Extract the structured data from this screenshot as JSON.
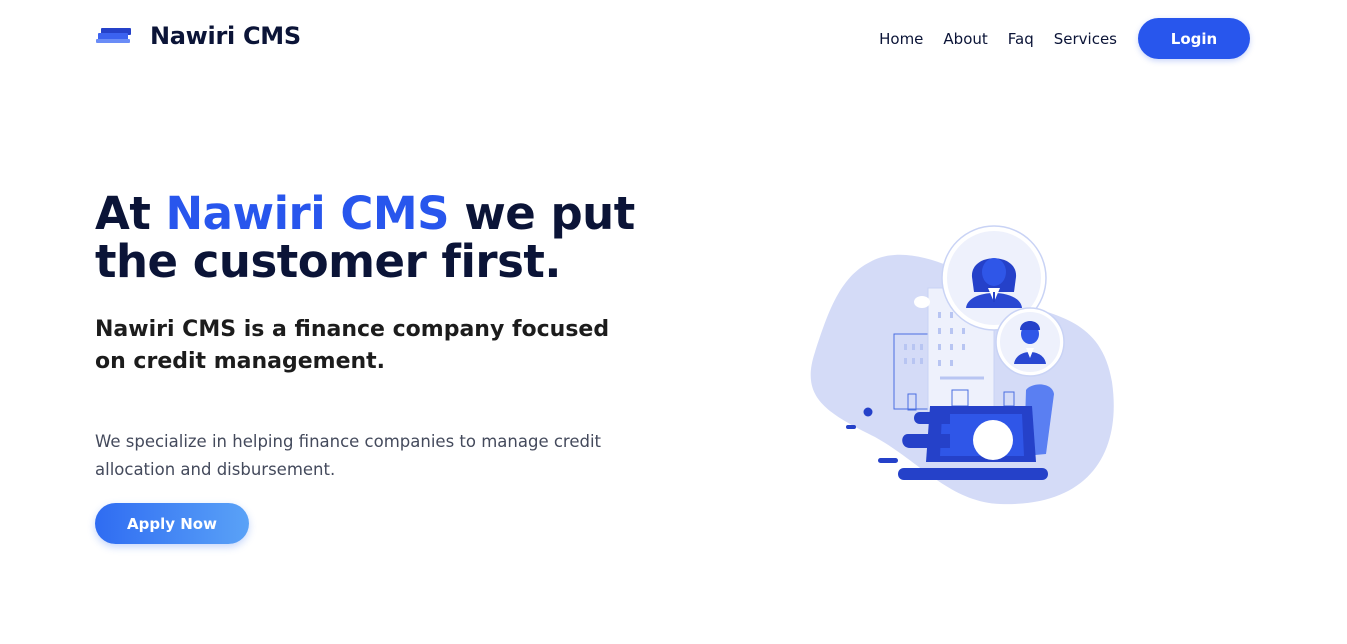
{
  "brand": {
    "name": "Nawiri CMS",
    "logo_icon": "layers-logo-icon"
  },
  "nav": {
    "links": [
      "Home",
      "About",
      "Faq",
      "Services"
    ],
    "login_label": "Login"
  },
  "hero": {
    "title_prefix": "At ",
    "title_accent": "Nawiri CMS",
    "title_suffix": " we put the customer first.",
    "subtitle": "Nawiri CMS is a finance company focused on credit management.",
    "description": "We specialize in helping finance companies to manage credit allocation and disbursement.",
    "cta_label": "Apply Now"
  },
  "colors": {
    "accent": "#2856ed",
    "heading": "#0b1437",
    "illustration_light": "#d4dbf7",
    "illustration_dark": "#2541c9"
  }
}
